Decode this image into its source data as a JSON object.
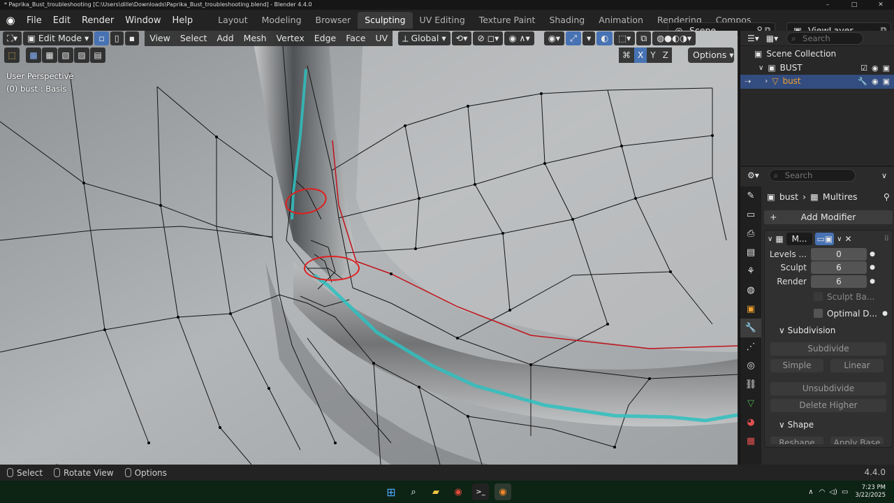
{
  "window": {
    "title": "* Paprika_Bust_troubleshooting [C:\\Users\\dille\\Downloads\\Paprika_Bust_troubleshooting.blend] - Blender 4.4.0",
    "controls": [
      "–",
      "□",
      "✕"
    ]
  },
  "menu": [
    "File",
    "Edit",
    "Render",
    "Window",
    "Help"
  ],
  "workspaces": [
    "Layout",
    "Modeling",
    "Browser",
    "Sculpting",
    "UV Editing",
    "Texture Paint",
    "Shading",
    "Animation",
    "Rendering",
    "Compositing"
  ],
  "active_workspace": "Sculpting",
  "scene": {
    "label": "Scene"
  },
  "viewlayer": {
    "label": "ViewLayer"
  },
  "viewport": {
    "mode": "Edit Mode",
    "menus": [
      "View",
      "Select",
      "Add",
      "Mesh",
      "Vertex",
      "Edge",
      "Face",
      "UV"
    ],
    "orientation": "Global",
    "perspective": "User Perspective",
    "object_info": "(0) bust : Basis",
    "axes": [
      "X",
      "Y",
      "Z"
    ],
    "options": "Options"
  },
  "outliner": {
    "search_placeholder": "Search",
    "scene_collection": "Scene Collection",
    "collection": "BUST",
    "object": "bust"
  },
  "properties": {
    "search_placeholder": "Search",
    "breadcrumb_object": "bust",
    "breadcrumb_modifier": "Multires",
    "add_modifier": "Add Modifier",
    "modifier_name": "M...",
    "fields": [
      {
        "label": "Levels ...",
        "value": "0"
      },
      {
        "label": "Sculpt",
        "value": "6"
      },
      {
        "label": "Render",
        "value": "6"
      }
    ],
    "sculpt_base": "Sculpt Ba...",
    "optimal_display": "Optimal D...",
    "subdivision_header": "Subdivision",
    "subdivide": "Subdivide",
    "simple": "Simple",
    "linear": "Linear",
    "unsubdivide": "Unsubdivide",
    "delete_higher": "Delete Higher",
    "shape_header": "Shape",
    "reshape": "Reshape",
    "apply_base": "Apply Base"
  },
  "statusbar": {
    "select": "Select",
    "rotate": "Rotate View",
    "options": "Options",
    "version": "4.4.0"
  },
  "taskbar": {
    "time": "7:23 PM",
    "date": "3/22/2025"
  },
  "colors": {
    "selection_blue": "#4772b3",
    "annotation_red": "#e01e1e",
    "seam_cyan": "#2fbfc0",
    "selected_edge": "#c0121b"
  }
}
